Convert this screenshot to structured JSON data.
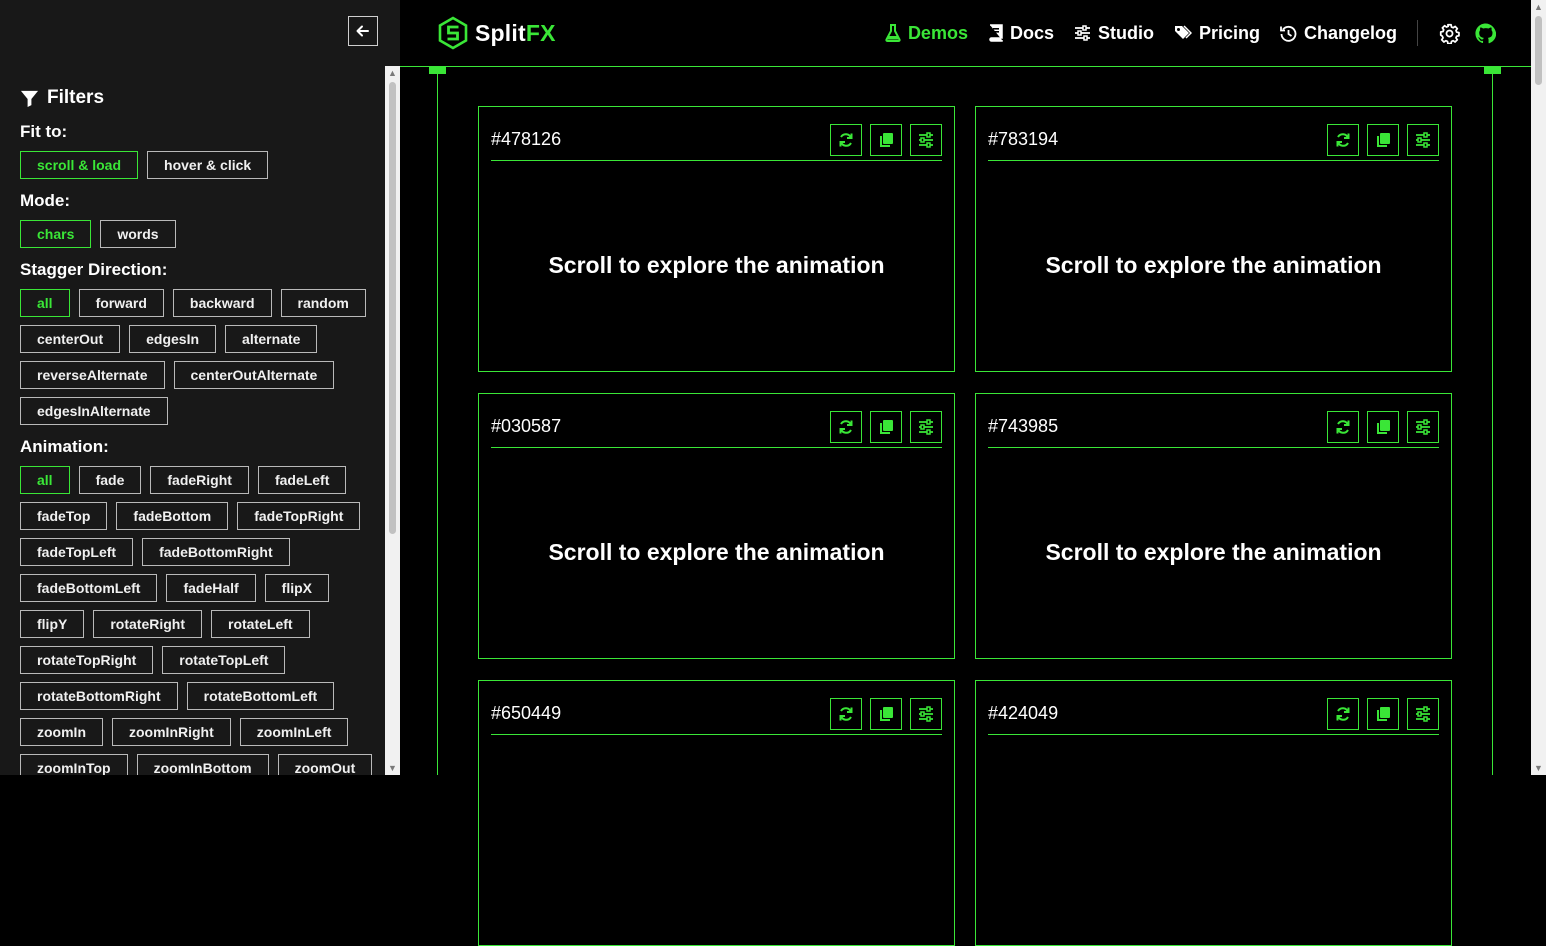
{
  "sidebar": {
    "filters_title": "Filters",
    "groups": [
      {
        "label": "Fit to:",
        "options": [
          "scroll & load",
          "hover & click"
        ],
        "active": 0
      },
      {
        "label": "Mode:",
        "options": [
          "chars",
          "words"
        ],
        "active": 0
      },
      {
        "label": "Stagger Direction:",
        "options": [
          "all",
          "forward",
          "backward",
          "random",
          "centerOut",
          "edgesIn",
          "alternate",
          "reverseAlternate",
          "centerOutAlternate",
          "edgesInAlternate"
        ],
        "active": 0
      },
      {
        "label": "Animation:",
        "options": [
          "all",
          "fade",
          "fadeRight",
          "fadeLeft",
          "fadeTop",
          "fadeBottom",
          "fadeTopRight",
          "fadeTopLeft",
          "fadeBottomRight",
          "fadeBottomLeft",
          "fadeHalf",
          "flipX",
          "flipY",
          "rotateRight",
          "rotateLeft",
          "rotateTopRight",
          "rotateTopLeft",
          "rotateBottomRight",
          "rotateBottomLeft",
          "zoomIn",
          "zoomInRight",
          "zoomInLeft",
          "zoomInTop",
          "zoomInBottom",
          "zoomOut"
        ],
        "active": 0
      }
    ]
  },
  "header": {
    "logo_main": "Split",
    "logo_accent": "FX",
    "nav": [
      {
        "label": "Demos",
        "icon": "flask-icon",
        "active": true
      },
      {
        "label": "Docs",
        "icon": "book-icon",
        "active": false
      },
      {
        "label": "Studio",
        "icon": "sliders-icon",
        "active": false
      },
      {
        "label": "Pricing",
        "icon": "tags-icon",
        "active": false
      },
      {
        "label": "Changelog",
        "icon": "history-icon",
        "active": false
      }
    ]
  },
  "cards": [
    {
      "id": "#478126",
      "message": "Scroll to explore the animation"
    },
    {
      "id": "#783194",
      "message": "Scroll to explore the animation"
    },
    {
      "id": "#030587",
      "message": "Scroll to explore the animation"
    },
    {
      "id": "#743985",
      "message": "Scroll to explore the animation"
    },
    {
      "id": "#650449",
      "message": ""
    },
    {
      "id": "#424049",
      "message": ""
    }
  ],
  "colors": {
    "accent": "#3ae637",
    "background": "#000000",
    "sidebar": "#181818"
  }
}
